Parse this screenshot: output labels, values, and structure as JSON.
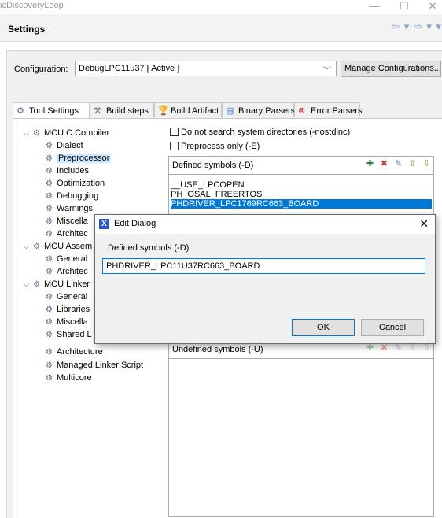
{
  "window": {
    "title": "icDiscoveryLoop",
    "minimize_glyph": "—",
    "maximize_glyph": "☐",
    "close_glyph": "✕"
  },
  "header": {
    "title": "Settings",
    "nav_glyphs": "⇦ ▾ ⇨ ▾ ▾"
  },
  "config": {
    "label": "Configuration:",
    "value": "DebugLPC11u37  [ Active ]",
    "manage_label": "Manage Configurations..."
  },
  "tabs": [
    {
      "label": "Tool Settings",
      "icon": "tool-settings-icon"
    },
    {
      "label": "Build steps",
      "icon": "build-steps-icon"
    },
    {
      "label": "Build Artifact",
      "icon": "build-artifact-icon"
    },
    {
      "label": "Binary Parsers",
      "icon": "binary-parsers-icon"
    },
    {
      "label": "Error Parsers",
      "icon": "error-parsers-icon"
    }
  ],
  "tree": [
    {
      "label": "MCU C Compiler",
      "level": 0,
      "expanded": true
    },
    {
      "label": "Dialect",
      "level": 1
    },
    {
      "label": "Preprocessor",
      "level": 1,
      "selected": true
    },
    {
      "label": "Includes",
      "level": 1
    },
    {
      "label": "Optimization",
      "level": 1
    },
    {
      "label": "Debugging",
      "level": 1
    },
    {
      "label": "Warnings",
      "level": 1
    },
    {
      "label": "Miscella",
      "level": 1
    },
    {
      "label": "Architec",
      "level": 1
    },
    {
      "label": "MCU Assem",
      "level": 0,
      "expanded": true
    },
    {
      "label": "General",
      "level": 1
    },
    {
      "label": "Architec",
      "level": 1
    },
    {
      "label": "MCU Linker",
      "level": 0,
      "expanded": true
    },
    {
      "label": "General",
      "level": 1
    },
    {
      "label": "Libraries",
      "level": 1
    },
    {
      "label": "Miscella",
      "level": 1
    },
    {
      "label": "Shared L",
      "level": 1
    },
    {
      "label": "Architecture",
      "level": 1
    },
    {
      "label": "Managed Linker Script",
      "level": 1
    },
    {
      "label": "Multicore",
      "level": 1
    }
  ],
  "options": {
    "nostdinc": "Do not search system directories (-nostdinc)",
    "preprocess_only": "Preprocess only (-E)"
  },
  "defined_symbols": {
    "title": "Defined symbols (-D)",
    "items": [
      "__USE_LPCOPEN",
      "PH_OSAL_FREERTOS",
      "PHDRIVER_LPC1769RC663_BOARD"
    ],
    "selected_index": 2
  },
  "undefined_symbols": {
    "title": "Undefined symbols (-U)"
  },
  "dialog": {
    "title": "Edit Dialog",
    "icon_letter": "X",
    "field_label": "Defined symbols (-D)",
    "field_value": "PHDRIVER_LPC11U37RC663_BOARD",
    "ok_label": "OK",
    "cancel_label": "Cancel"
  }
}
